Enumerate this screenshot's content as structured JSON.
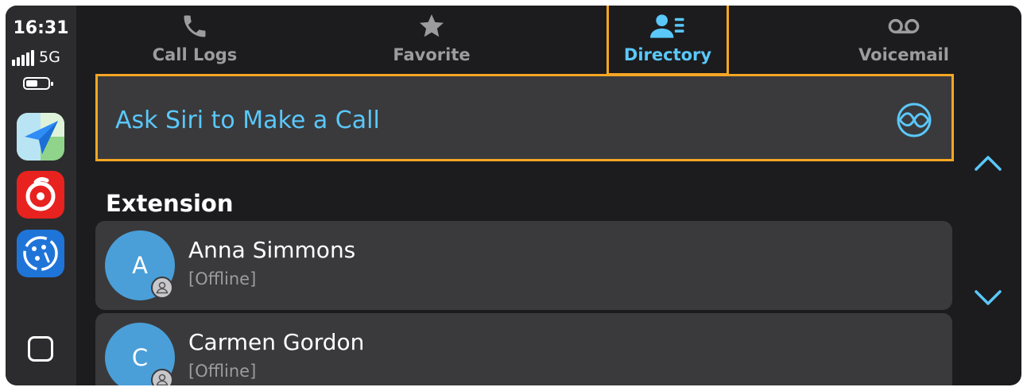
{
  "status_bar": {
    "time": "16:31",
    "network": "5G"
  },
  "dock": {
    "apps": [
      {
        "name": "maps-app-icon"
      },
      {
        "name": "netease-music-app-icon"
      },
      {
        "name": "softphone-app-icon"
      }
    ]
  },
  "tabs": [
    {
      "label": "Call Logs",
      "icon": "phone-icon",
      "active": false
    },
    {
      "label": "Favorite",
      "icon": "star-icon",
      "active": false
    },
    {
      "label": "Directory",
      "icon": "contacts-icon",
      "active": true
    },
    {
      "label": "Voicemail",
      "icon": "voicemail-icon",
      "active": false
    }
  ],
  "siri": {
    "label": "Ask Siri to Make a Call",
    "icon": "siri-icon"
  },
  "section": {
    "title": "Extension"
  },
  "contacts": [
    {
      "initial": "A",
      "name": "Anna Simmons",
      "status": "[Offline]"
    },
    {
      "initial": "C",
      "name": "Carmen Gordon",
      "status": "[Offline]"
    }
  ],
  "colors": {
    "accent": "#5ac8fa",
    "highlight": "#f5a623",
    "background": "#1c1c1e",
    "card": "#3a3a3c",
    "avatar": "#4a9fd8"
  }
}
